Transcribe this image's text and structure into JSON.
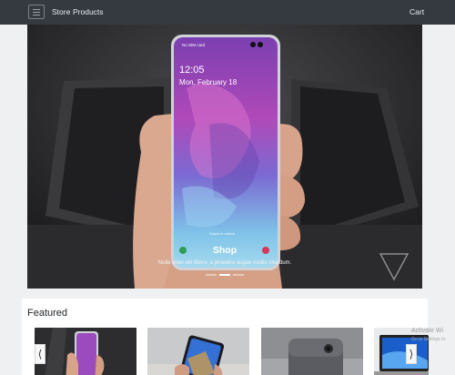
{
  "navbar": {
    "store": "Store",
    "products": "Products",
    "cart": "Cart"
  },
  "hero": {
    "phone_status": "No SIM card",
    "phone_time": "12:05",
    "phone_date": "Mon, February 18",
    "phone_swipe": "Swipe to unlock",
    "title": "Shop",
    "text": "Nulla vitae elit libero, a pharetra augue mollis interdum.",
    "slides": 3,
    "active_slide": 1
  },
  "featured": {
    "title": "Featured"
  },
  "carousel": {
    "prev_label": "⟨",
    "next_label": "⟩"
  },
  "watermark": {
    "line1": "Activate Wi",
    "line2": "Go to Settings to"
  }
}
